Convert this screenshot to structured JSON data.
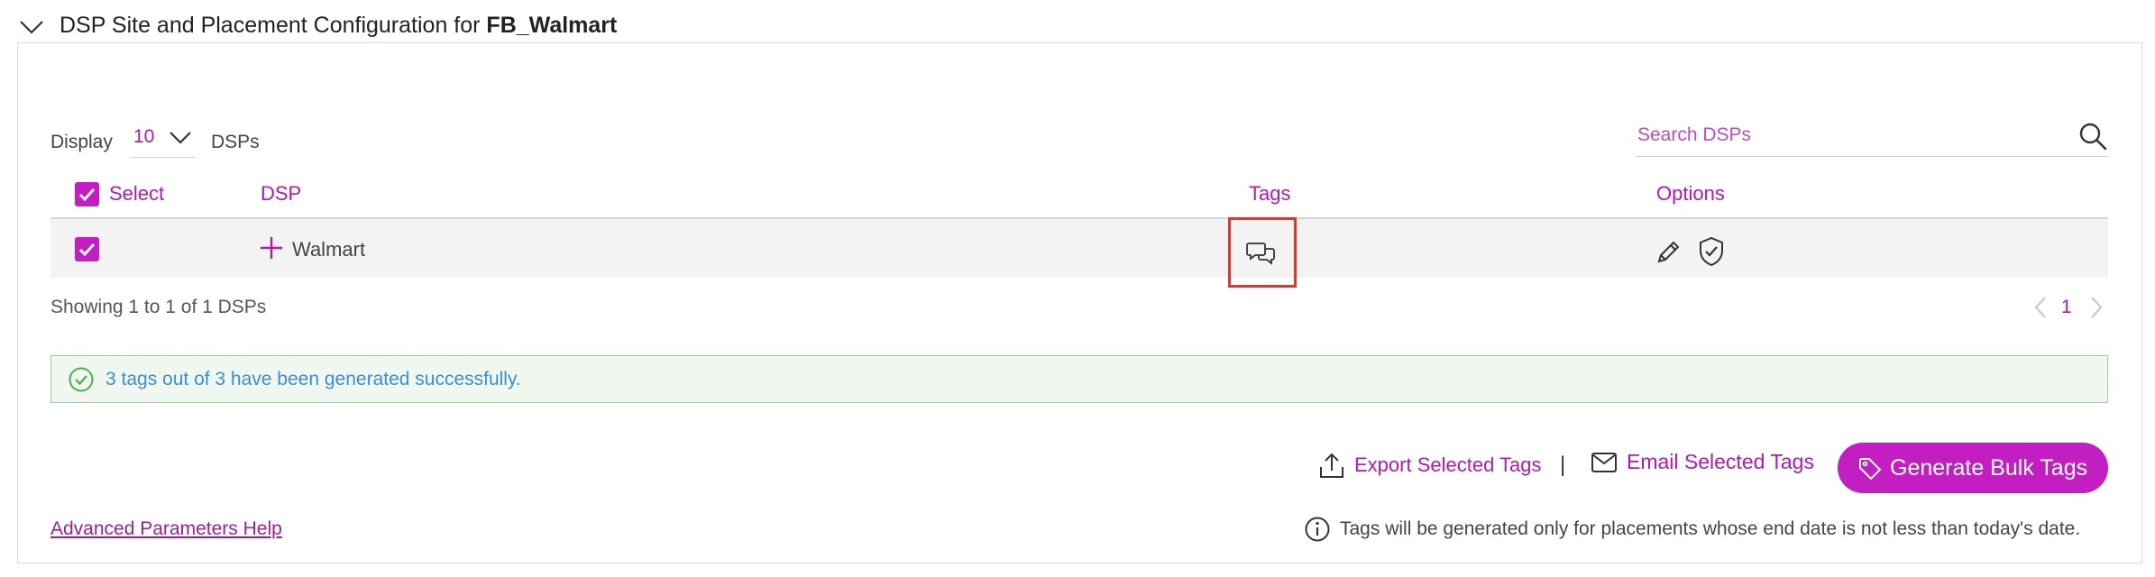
{
  "header": {
    "title_prefix": "DSP Site and Placement Configuration for",
    "title_entity": "FB_Walmart",
    "collapse_icon": "chevron-down-icon"
  },
  "display": {
    "label": "Display",
    "value": "10",
    "suffix": "DSPs"
  },
  "search": {
    "placeholder": "Search DSPs",
    "icon": "search-icon"
  },
  "table": {
    "columns": {
      "select": "Select",
      "dsp": "DSP",
      "tags": "Tags",
      "options": "Options"
    },
    "select_all_checked": true,
    "rows": [
      {
        "checked": true,
        "dsp": "Walmart",
        "expand_icon": "plus-icon",
        "tags_icon": "chat-bubbles-icon",
        "option_icons": [
          "pencil-icon",
          "shield-check-icon"
        ]
      }
    ]
  },
  "pagination": {
    "summary": "Showing 1 to 1 of 1 DSPs",
    "current_page": "1"
  },
  "status": {
    "message": "3 tags out of 3 have been generated successfully.",
    "icon": "check-circle-icon"
  },
  "actions": {
    "export_label": "Export Selected Tags",
    "separator": "|",
    "email_label": "Email Selected Tags",
    "generate_label": "Generate Bulk Tags"
  },
  "footer": {
    "help_link": "Advanced Parameters Help",
    "note": "Tags will be generated only for placements whose end date is not less than today's date."
  },
  "colors": {
    "accent": "#c21ec2",
    "link": "#b517b5",
    "success_bg": "#f0f7ef",
    "success_border": "#9ecf9e",
    "success_text": "#3b8fd6",
    "highlight": "#e0392b"
  }
}
